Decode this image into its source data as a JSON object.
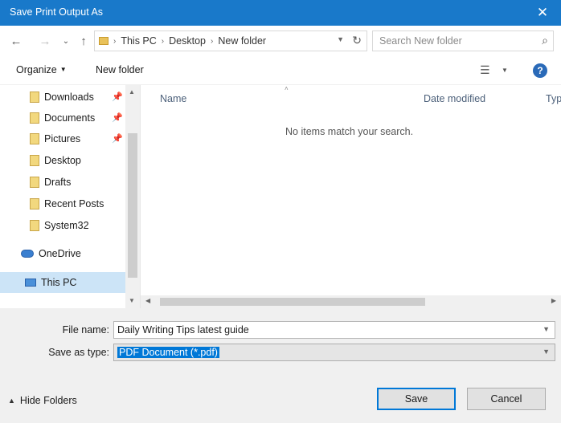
{
  "window": {
    "title": "Save Print Output As",
    "close_glyph": "✕"
  },
  "navigation": {
    "back_glyph": "←",
    "forward_glyph": "→",
    "recent_glyph": "⌄",
    "up_glyph": "↑"
  },
  "address": {
    "breadcrumbs": [
      "This PC",
      "Desktop",
      "New folder"
    ],
    "separator": "›"
  },
  "search": {
    "placeholder": "Search New folder"
  },
  "toolbar": {
    "organize_label": "Organize",
    "new_folder_label": "New folder",
    "help_glyph": "?"
  },
  "sidebar": {
    "items": [
      {
        "label": "Downloads",
        "icon": "download-folder-icon",
        "pinned": true
      },
      {
        "label": "Documents",
        "icon": "documents-folder-icon",
        "pinned": true
      },
      {
        "label": "Pictures",
        "icon": "pictures-folder-icon",
        "pinned": true
      },
      {
        "label": "Desktop",
        "icon": "folder-icon",
        "pinned": false
      },
      {
        "label": "Drafts",
        "icon": "folder-icon",
        "pinned": false
      },
      {
        "label": "Recent Posts",
        "icon": "folder-icon",
        "pinned": false
      },
      {
        "label": "System32",
        "icon": "folder-icon",
        "pinned": false
      },
      {
        "label": "OneDrive",
        "icon": "cloud-icon",
        "pinned": false
      },
      {
        "label": "This PC",
        "icon": "computer-icon",
        "pinned": false,
        "selected": true
      }
    ]
  },
  "file_list": {
    "columns": [
      "Name",
      "Date modified",
      "Typ"
    ],
    "empty_message": "No items match your search."
  },
  "form": {
    "file_name_label": "File name:",
    "file_name_value": "Daily Writing Tips latest guide",
    "save_type_label": "Save as type:",
    "save_type_value": "PDF Document (*.pdf)"
  },
  "footer": {
    "hide_folders_label": "Hide Folders",
    "save_label": "Save",
    "cancel_label": "Cancel"
  },
  "colors": {
    "titlebar": "#1979ca",
    "selection": "#cce4f7",
    "accent": "#0078d7"
  }
}
